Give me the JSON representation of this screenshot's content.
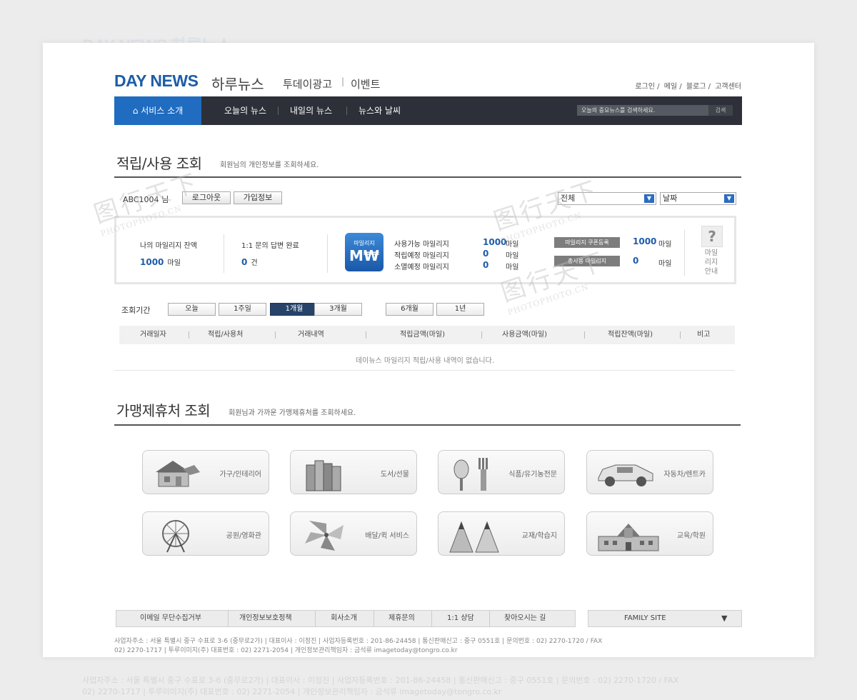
{
  "ghost": {
    "title": "DAY NEWS 하루뉴스"
  },
  "ghost_footer": {
    "line1": "사업자주소 : 서울 특별시 중구 수표로 3-6 (중무로2가) | 대표이사 : 이정진 | 사업자등록번호 : 201-86-24458 | 통신판매신고 : 중구 0551호 | 문의번호 : 02) 2270-1720 / FAX",
    "line2": "02) 2270-1717 | 투루이미지(주) 대표번호 : 02) 2271-2054 | 개인정보관리책임자 : 금석류 imagetoday@tongro.co.kr"
  },
  "header": {
    "logo": "DAY NEWS",
    "logo_sub": "하루뉴스",
    "link1": "투데이광고",
    "link2": "이벤트",
    "util": [
      "로그인",
      "메일",
      "블로그",
      "고객센터"
    ]
  },
  "nav": {
    "home": "서비스 소개",
    "items": [
      "오늘의 뉴스",
      "내일의 뉴스",
      "뉴스와 날씨"
    ],
    "search_placeholder": "오늘의 중요뉴스를 검색하세요.",
    "search_btn": "검색"
  },
  "section1": {
    "title": "적립/사용 조회",
    "subtitle": "회원님의 개인정보를 조회하세요."
  },
  "user": {
    "id": "ABC1004",
    "suffix": "님",
    "logout": "로그아웃",
    "info": "가입정보"
  },
  "filters": {
    "select1": "전체",
    "select2": "날짜"
  },
  "summary": {
    "balance_label": "나의 마일리지 잔액",
    "balance_value": "1000",
    "unit": "마일",
    "qa_label": "1:1 문의 답변 완료",
    "qa_value": "0",
    "qa_unit": "건",
    "badge_top": "마일리지",
    "badge_main": "M₩",
    "rows": [
      {
        "label": "사용가능 마일리지",
        "value": "1000",
        "unit": "마일"
      },
      {
        "label": "적립예정 마일리지",
        "value": "0",
        "unit": "마일"
      },
      {
        "label": "소멸예정 마일리지",
        "value": "0",
        "unit": "마일"
      }
    ],
    "coupon_btn": "마일리지 쿠폰등록",
    "coupon_value": "1000",
    "used_btn": "총사용 마일리지",
    "used_value": "0",
    "help_icon": "?",
    "help_lines": [
      "마일",
      "리지",
      "안내"
    ]
  },
  "period": {
    "label": "조회기간",
    "tabs": [
      "오늘",
      "1주일",
      "1개월",
      "3개월",
      "6개월",
      "1년"
    ],
    "active": "1개월"
  },
  "table": {
    "headers": [
      "거래일자",
      "적립/사용처",
      "거래내역",
      "적립금액(마일)",
      "사용금액(마일)",
      "적립잔액(마일)",
      "비고"
    ],
    "empty": "데이뉴스 마일리지 적립/사용 내역이 없습니다."
  },
  "section2": {
    "title": "가맹제휴처 조회",
    "subtitle": "회원님과 가까운 가맹제휴처를 조회하세요."
  },
  "categories": [
    {
      "label": "가구/인테리어",
      "icon": "house-icon"
    },
    {
      "label": "도서/선물",
      "icon": "books-icon"
    },
    {
      "label": "식품/유기농전문",
      "icon": "utensils-icon"
    },
    {
      "label": "자동차/렌트카",
      "icon": "car-icon"
    },
    {
      "label": "공원/영화관",
      "icon": "ferris-wheel-icon"
    },
    {
      "label": "배달/퀵 서비스",
      "icon": "pinwheel-icon"
    },
    {
      "label": "교재/학습지",
      "icon": "pencils-icon"
    },
    {
      "label": "교육/학원",
      "icon": "school-icon"
    }
  ],
  "footer": {
    "links": [
      "이메일 무단수집거부",
      "개인정보보호정책",
      "회사소개",
      "제휴문의",
      "1:1 상담",
      "찾아오시는 길"
    ],
    "family": "FAMILY SITE",
    "line1": "사업자주소 : 서울 특별시 중구 수표로 3-6 (중무로2가) | 대표이사 : 이정진 | 사업자등록번호 : 201-86-24458 | 통신판매신고 : 중구 0551호 | 문의번호 : 02) 2270-1720 / FAX",
    "line2": "02) 2270-1717 | 투루이미지(주) 대표번호 : 02) 2271-2054 | 개인정보관리책임자 : 금석류 imagetoday@tongro.co.kr"
  },
  "watermark": {
    "text": "图行天下",
    "sub": "PHOTOPHOTO.CN"
  }
}
